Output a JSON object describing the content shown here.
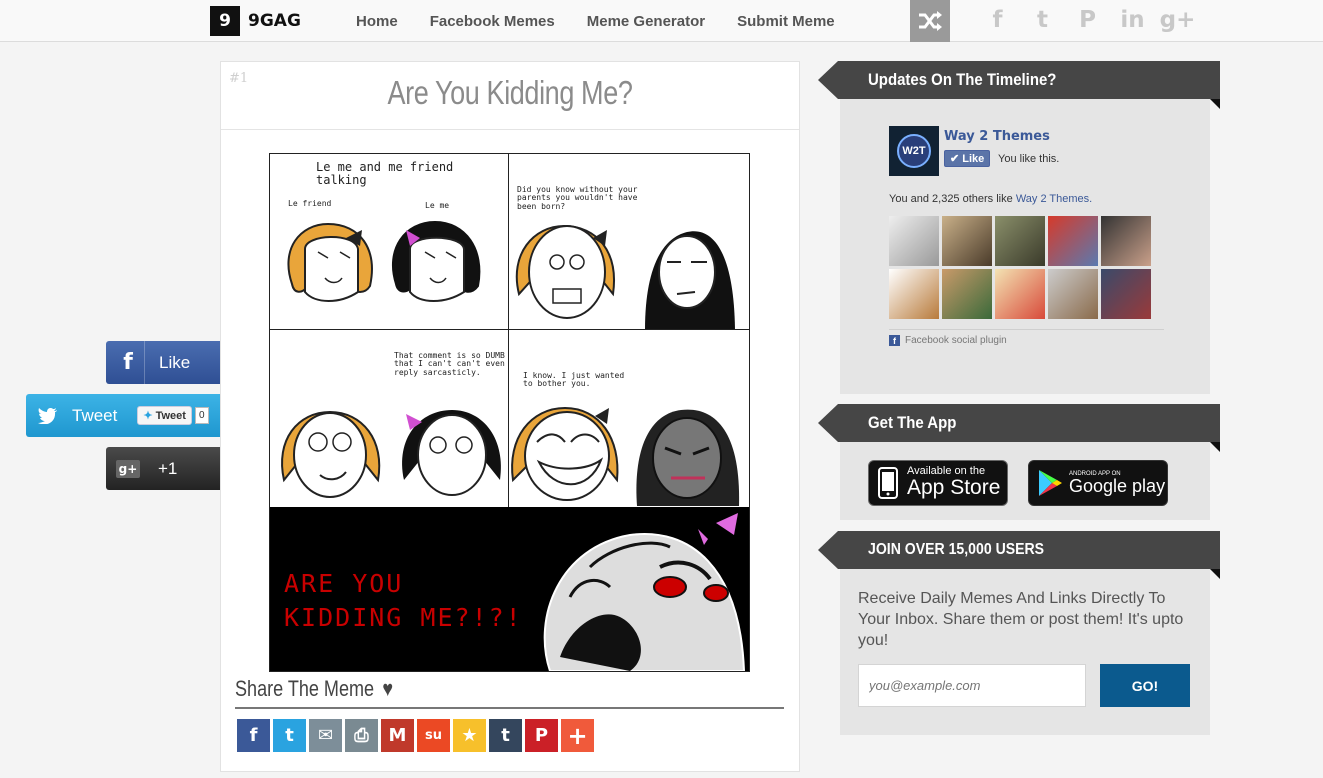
{
  "header": {
    "logo_mark": "9",
    "logo_text": "9GAG",
    "nav": [
      "Home",
      "Facebook Memes",
      "Meme Generator",
      "Submit Meme"
    ],
    "social": [
      {
        "icon": "facebook-icon",
        "glyph": "f"
      },
      {
        "icon": "twitter-icon",
        "glyph": "t"
      },
      {
        "icon": "pinterest-icon",
        "glyph": "P"
      },
      {
        "icon": "linkedin-icon",
        "glyph": "in"
      },
      {
        "icon": "google-plus-icon",
        "glyph": "g+"
      }
    ]
  },
  "floating_share": {
    "facebook_label": "Like",
    "twitter_label": "Tweet",
    "twitter_mini_label": "Tweet",
    "twitter_count": "0",
    "gplus_label": "+1"
  },
  "post": {
    "number": "#1",
    "title": "Are You Kidding Me?",
    "comic": {
      "p1_caption": "Le me and me friend\ntalking",
      "p1_left": "Le friend",
      "p1_right": "Le me",
      "p2_caption": "Did you know without your\nparents you wouldn't have\nbeen born?",
      "p3_caption": "That comment is so DUMB\nthat I can't can't even\nreply sarcasticly.",
      "p4_caption": "I know. I just wanted\nto bother you.",
      "p5_caption": "ARE YOU\nKIDDING ME?!?!"
    },
    "share_title": "Share The Meme",
    "share_buttons": [
      {
        "name": "facebook-share-button",
        "glyph": "f",
        "color": "#3b5998"
      },
      {
        "name": "twitter-share-button",
        "glyph": "t",
        "color": "#2aa3e0"
      },
      {
        "name": "email-share-button",
        "glyph": "✉",
        "color": "#7d8e99"
      },
      {
        "name": "print-share-button",
        "glyph": "⎙",
        "color": "#7a8a92"
      },
      {
        "name": "gmail-share-button",
        "glyph": "M",
        "color": "#c0392b"
      },
      {
        "name": "stumbleupon-share-button",
        "glyph": "su",
        "color": "#eb4924"
      },
      {
        "name": "favorite-share-button",
        "glyph": "★",
        "color": "#f7c02b"
      },
      {
        "name": "tumblr-share-button",
        "glyph": "t",
        "color": "#34465d"
      },
      {
        "name": "pinterest-share-button",
        "glyph": "P",
        "color": "#cb2027"
      },
      {
        "name": "more-share-button",
        "glyph": "+",
        "color": "#f05a3b"
      }
    ]
  },
  "sidebar": {
    "timeline": {
      "title": "Updates On The Timeline?",
      "page_logo": "W2T",
      "page_name": "Way 2 Themes",
      "like_label": "Like",
      "you_like": "You like this.",
      "others_prefix": "You and 2,325 others like ",
      "others_link": "Way 2 Themes.",
      "plugin_label": "Facebook social plugin"
    },
    "app": {
      "title": "Get The App",
      "appstore_small": "Available on the",
      "appstore_big": "App Store",
      "googleplay_small": "ANDROID APP ON",
      "googleplay_big": "Google play"
    },
    "newsletter": {
      "title": "JOIN OVER 15,000 USERS",
      "text": "Receive Daily Memes And Links Directly To Your Inbox. Share them or post them! It's upto you!",
      "placeholder": "you@example.com",
      "button": "GO!"
    }
  }
}
